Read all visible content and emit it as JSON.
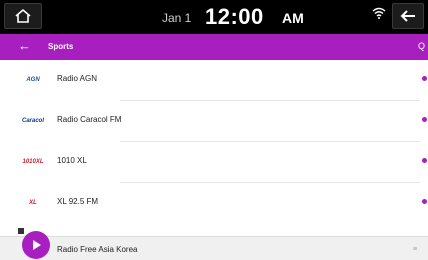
{
  "status_bar": {
    "date": "Jan 1",
    "time": "12:00",
    "ampm": "AM",
    "icons": [
      "home-icon",
      "wifi-icon",
      "back-arrow-icon"
    ]
  },
  "title_bar": {
    "back": "←",
    "title": "Sports",
    "search": "Q"
  },
  "stations": [
    {
      "name": "Radio AGN",
      "logo_text": "AGN",
      "logo_color": "#1d4f9c"
    },
    {
      "name": "Radio Caracol FM",
      "logo_text": "Caracol",
      "logo_color": "#0a3d8c"
    },
    {
      "name": "1010 XL",
      "logo_text": "1010XL",
      "logo_color": "#cc1f2a"
    },
    {
      "name": "XL 92.5 FM",
      "logo_text": "XL",
      "logo_color": "#d0162c"
    }
  ],
  "now_playing": {
    "name": "Radio Free Asia Korea"
  },
  "colors": {
    "accent": "#a81fbf",
    "status_bg": "#000000"
  }
}
